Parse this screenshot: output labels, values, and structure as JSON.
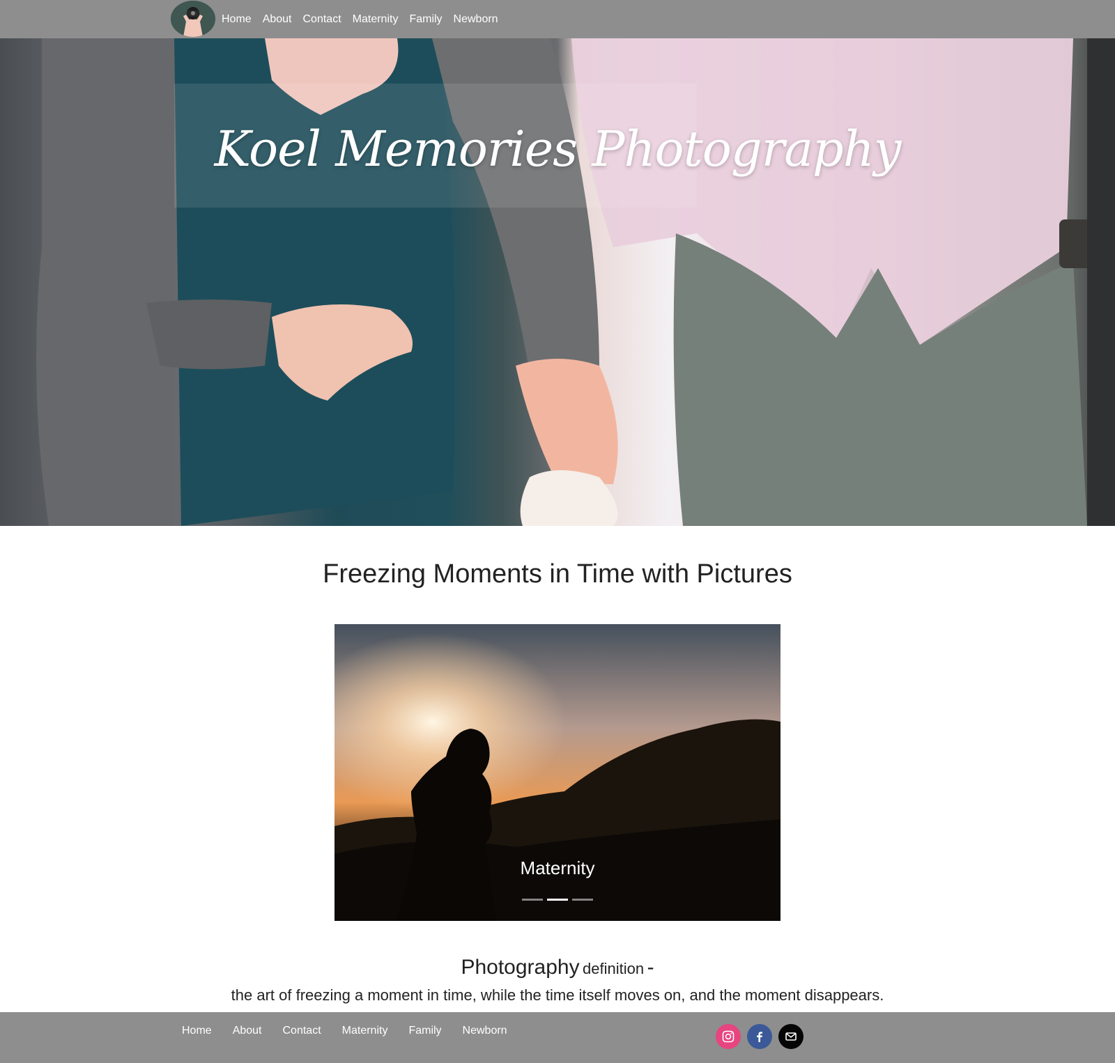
{
  "nav": {
    "logo": "photographer-avatar-logo",
    "links": [
      "Home",
      "About",
      "Contact",
      "Maternity",
      "Family",
      "Newborn"
    ]
  },
  "hero": {
    "title": "Koel Memories Photography"
  },
  "main": {
    "heading": "Freezing Moments in Time with Pictures",
    "carousel": {
      "caption": "Maternity",
      "slide_count": 3,
      "active_index": 1
    },
    "definition": {
      "word": "Photography",
      "label": "definition",
      "dash": "-",
      "text": "the art of freezing a moment in time, while the time itself moves on, and the moment disappears."
    }
  },
  "footer": {
    "links": [
      "Home",
      "About",
      "Contact",
      "Maternity",
      "Family",
      "Newborn"
    ],
    "social": [
      {
        "name": "instagram-icon",
        "color": "#e6457f"
      },
      {
        "name": "facebook-icon",
        "color": "#3b5998"
      },
      {
        "name": "email-icon",
        "color": "#050505"
      }
    ]
  },
  "colors": {
    "nav_bg": "#8e8e8e",
    "text": "#222222",
    "white": "#ffffff"
  }
}
